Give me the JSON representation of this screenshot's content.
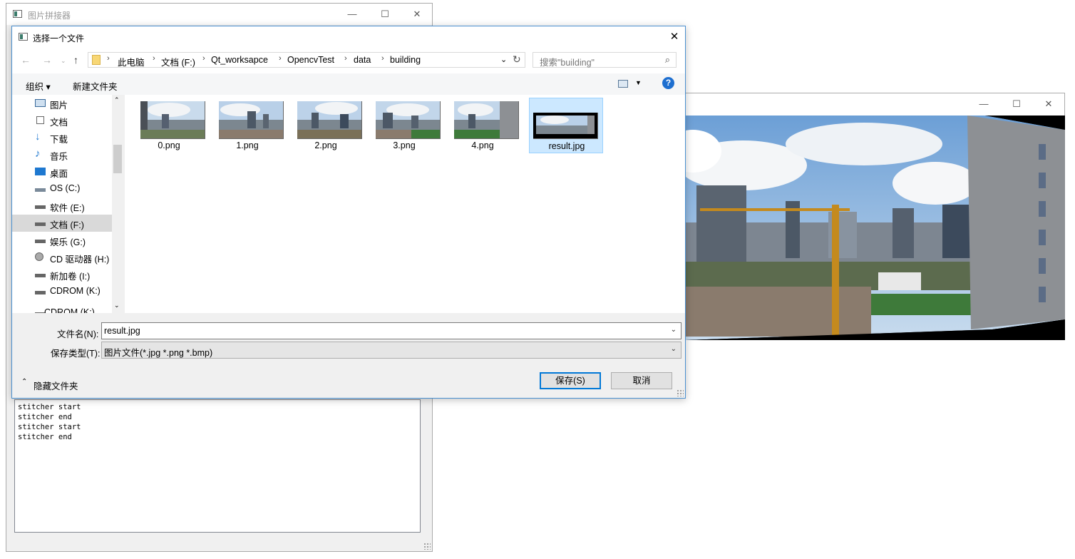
{
  "main_window": {
    "title": "图片拼接器",
    "log_text": "stitcher start\nstitcher end\nstitcher start\nstitcher end"
  },
  "image_window": {
    "title": ""
  },
  "dialog": {
    "title": "选择一个文件",
    "address": [
      "此电脑",
      "文档 (F:)",
      "Qt_worksapce",
      "OpencvTest",
      "data",
      "building"
    ],
    "search_placeholder": "搜索\"building\"",
    "toolbar": {
      "organize": "组织 ▾",
      "new_folder": "新建文件夹"
    },
    "nav_items": [
      {
        "label": "图片",
        "icon": "pictures-icon"
      },
      {
        "label": "文档",
        "icon": "documents-icon"
      },
      {
        "label": "下载",
        "icon": "downloads-icon"
      },
      {
        "label": "音乐",
        "icon": "music-icon"
      },
      {
        "label": "桌面",
        "icon": "desktop-icon"
      },
      {
        "label": "OS (C:)",
        "icon": "system-drive-icon"
      },
      {
        "label": "软件 (E:)",
        "icon": "drive-icon"
      },
      {
        "label": "文档 (F:)",
        "icon": "drive-icon",
        "selected": true
      },
      {
        "label": "娱乐 (G:)",
        "icon": "drive-icon"
      },
      {
        "label": "CD 驱动器 (H:)",
        "icon": "cd-drive-icon"
      },
      {
        "label": "新加卷 (I:)",
        "icon": "drive-icon"
      },
      {
        "label": "CDROM (K:)",
        "icon": "drive-icon"
      },
      {
        "label": "CDROM (K:)",
        "icon": "drive-icon"
      }
    ],
    "files": [
      {
        "name": "0.png"
      },
      {
        "name": "1.png"
      },
      {
        "name": "2.png"
      },
      {
        "name": "3.png"
      },
      {
        "name": "4.png"
      },
      {
        "name": "result.jpg",
        "selected": true
      }
    ],
    "filename_label": "文件名(N):",
    "filename_value": "result.jpg",
    "filetype_label": "保存类型(T):",
    "filetype_value": "图片文件(*.jpg *.png *.bmp)",
    "hide_folders": "隐藏文件夹",
    "save_button": "保存(S)",
    "cancel_button": "取消"
  },
  "colors": {
    "accent": "#0078d7",
    "selection": "#cce8ff",
    "help": "#1e6fd0"
  }
}
